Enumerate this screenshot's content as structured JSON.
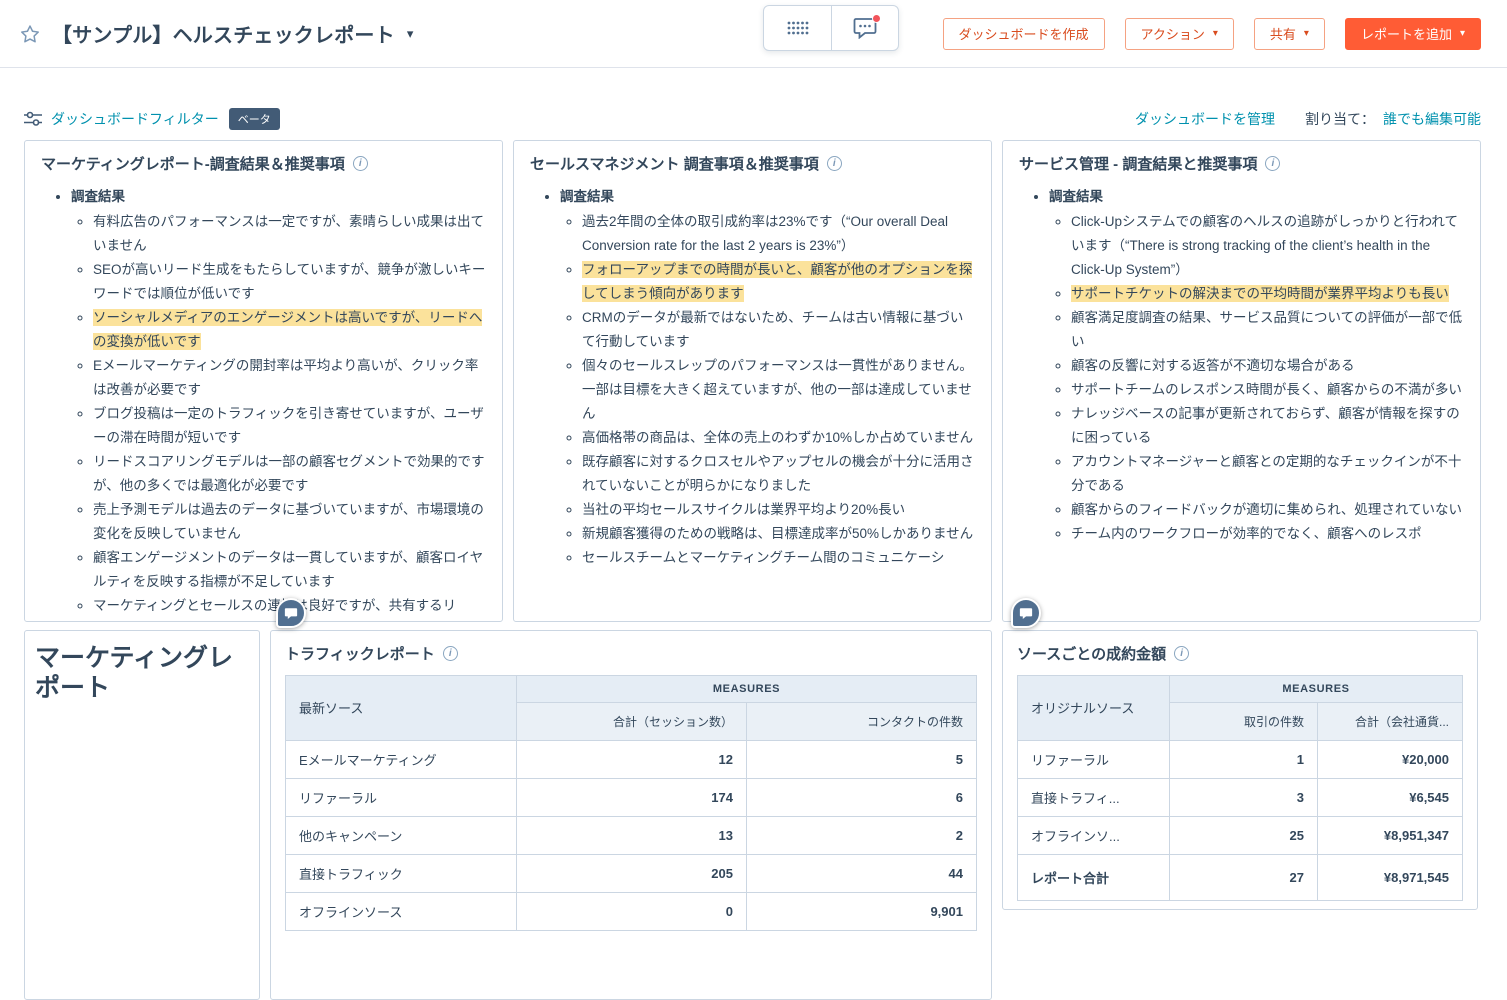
{
  "icons": {
    "info": "i",
    "caret": "▾"
  },
  "colors": {
    "accent_orange": "#ff5c35",
    "link_blue": "#0091ae",
    "highlight_yellow": "#fbe29b",
    "badge_navy": "#425b76",
    "text_dark": "#33475b",
    "border_gray": "#cbd6e2"
  },
  "header": {
    "title": "【サンプル】ヘルスチェックレポート",
    "create_dashboard_label": "ダッシュボードを作成",
    "actions_label": "アクション",
    "share_label": "共有",
    "add_report_label": "レポートを追加"
  },
  "toolbar": {
    "filter_label": "ダッシュボードフィルター",
    "beta_label": "ベータ",
    "manage_label": "ダッシュボードを管理",
    "assign_label": "割り当て：",
    "permission_label": "誰でも編集可能"
  },
  "reports": {
    "marketing": {
      "title": "マーケティングレポート-調査結果＆推奨事項",
      "section": "調査結果",
      "items": [
        "有料広告のパフォーマンスは一定ですが、素晴らしい成果は出ていません",
        "SEOが高いリード生成をもたらしていますが、競争が激しいキーワードでは順位が低いです",
        "ソーシャルメディアのエンゲージメントは高いですが、リードへの変換が低いです",
        "Eメールマーケティングの開封率は平均より高いが、クリック率は改善が必要です",
        "ブログ投稿は一定のトラフィックを引き寄せていますが、ユーザーの滞在時間が短いです",
        "リードスコアリングモデルは一部の顧客セグメントで効果的ですが、他の多くでは最適化が必要です",
        "売上予測モデルは過去のデータに基づいていますが、市場環境の変化を反映していません",
        "顧客エンゲージメントのデータは一貫していますが、顧客ロイヤルティを反映する指標が不足しています",
        "マーケティングとセールスの連携は良好ですが、共有するリ"
      ]
    },
    "sales": {
      "title": "セールスマネジメント 調査事項＆推奨事項",
      "section": "調査結果",
      "items": [
        "過去2年間の全体の取引成約率は23%です（“Our overall Deal Conversion rate for the last 2 years is 23%”）",
        "フォローアップまでの時間が長いと、顧客が他のオプションを探してしまう傾向があります",
        "CRMのデータが最新ではないため、チームは古い情報に基づいて行動しています",
        "個々のセールスレップのパフォーマンスは一貫性がありません。一部は目標を大きく超えていますが、他の一部は達成していません",
        "高価格帯の商品は、全体の売上のわずか10%しか占めていません",
        "既存顧客に対するクロスセルやアップセルの機会が十分に活用されていないことが明らかになりました",
        "当社の平均セールスサイクルは業界平均より20%長い",
        "新規顧客獲得のための戦略は、目標達成率が50%しかありません",
        "セールスチームとマーケティングチーム間のコミュニケーシ"
      ]
    },
    "service": {
      "title": "サービス管理 - 調査結果と推奨事項",
      "section": "調査結果",
      "items": [
        "Click-Upシステムでの顧客のヘルスの追跡がしっかりと行われています（“There is strong tracking of the client’s health in the Click-Up System”）",
        "サポートチケットの解決までの平均時間が業界平均よりも長い",
        "顧客満足度調査の結果、サービス品質についての評価が一部で低い",
        "顧客の反響に対する返答が不適切な場合がある",
        "サポートチームのレスポンス時間が長く、顧客からの不満が多い",
        "ナレッジベースの記事が更新されておらず、顧客が情報を探すのに困っている",
        "アカウントマネージャーと顧客との定期的なチェックインが不十分である",
        "顧客からのフィードバックが適切に集められ、処理されていない",
        "チーム内のワークフローが効率的でなく、顧客へのレスポ"
      ]
    }
  },
  "bottom": {
    "text_card_title": "マーケティングレポート",
    "traffic": {
      "title": "トラフィックレポート",
      "measures_label": "MEASURES",
      "row_header": "最新ソース",
      "columns": [
        "合計（セッション数）",
        "コンタクトの件数"
      ],
      "rows": [
        {
          "label": "Eメールマーケティング",
          "values": [
            "12",
            "5"
          ]
        },
        {
          "label": "リファーラル",
          "values": [
            "174",
            "6"
          ]
        },
        {
          "label": "他のキャンペーン",
          "values": [
            "13",
            "2"
          ]
        },
        {
          "label": "直接トラフィック",
          "values": [
            "205",
            "44"
          ]
        },
        {
          "label": "オフラインソース",
          "values": [
            "0",
            "9,901"
          ]
        }
      ]
    },
    "deals": {
      "title": "ソースごとの成約金額",
      "measures_label": "MEASURES",
      "row_header": "オリジナルソース",
      "columns": [
        "取引の件数",
        "合計（会社通貨..."
      ],
      "rows": [
        {
          "label": "リファーラル",
          "values": [
            "1",
            "¥20,000"
          ]
        },
        {
          "label": "直接トラフィ...",
          "values": [
            "3",
            "¥6,545"
          ]
        },
        {
          "label": "オフラインソ...",
          "values": [
            "25",
            "¥8,951,347"
          ]
        },
        {
          "label": "レポート合計",
          "values": [
            "27",
            "¥8,971,545"
          ]
        }
      ]
    }
  }
}
